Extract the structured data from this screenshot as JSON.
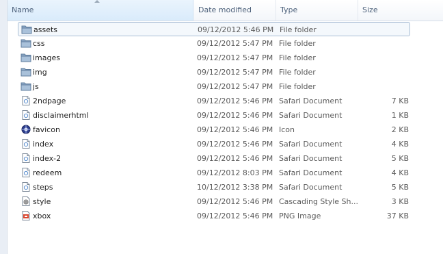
{
  "columns": {
    "name": "Name",
    "date_modified": "Date modified",
    "type": "Type",
    "size": "Size"
  },
  "files": [
    {
      "name": "assets",
      "date": "09/12/2012 5:46 PM",
      "type": "File folder",
      "size": "",
      "icon": "folder-icon",
      "selected": true
    },
    {
      "name": "css",
      "date": "09/12/2012 5:47 PM",
      "type": "File folder",
      "size": "",
      "icon": "folder-icon"
    },
    {
      "name": "images",
      "date": "09/12/2012 5:47 PM",
      "type": "File folder",
      "size": "",
      "icon": "folder-icon"
    },
    {
      "name": "img",
      "date": "09/12/2012 5:47 PM",
      "type": "File folder",
      "size": "",
      "icon": "folder-icon"
    },
    {
      "name": "js",
      "date": "09/12/2012 5:47 PM",
      "type": "File folder",
      "size": "",
      "icon": "folder-icon"
    },
    {
      "name": "2ndpage",
      "date": "09/12/2012 5:46 PM",
      "type": "Safari Document",
      "size": "7 KB",
      "icon": "document-icon"
    },
    {
      "name": "disclaimerhtml",
      "date": "09/12/2012 5:46 PM",
      "type": "Safari Document",
      "size": "1 KB",
      "icon": "document-icon"
    },
    {
      "name": "favicon",
      "date": "09/12/2012 5:46 PM",
      "type": "Icon",
      "size": "2 KB",
      "icon": "favicon-icon"
    },
    {
      "name": "index",
      "date": "09/12/2012 5:46 PM",
      "type": "Safari Document",
      "size": "4 KB",
      "icon": "document-icon"
    },
    {
      "name": "index-2",
      "date": "09/12/2012 5:46 PM",
      "type": "Safari Document",
      "size": "5 KB",
      "icon": "document-icon"
    },
    {
      "name": "redeem",
      "date": "09/12/2012 8:03 PM",
      "type": "Safari Document",
      "size": "4 KB",
      "icon": "document-icon"
    },
    {
      "name": "steps",
      "date": "10/12/2012 3:38 PM",
      "type": "Safari Document",
      "size": "5 KB",
      "icon": "document-icon"
    },
    {
      "name": "style",
      "date": "09/12/2012 5:46 PM",
      "type": "Cascading Style Sh...",
      "size": "3 KB",
      "icon": "stylesheet-icon"
    },
    {
      "name": "xbox",
      "date": "09/12/2012 5:46 PM",
      "type": "PNG Image",
      "size": "37 KB",
      "icon": "image-icon"
    }
  ],
  "colors": {
    "header_text": "#4c607a",
    "sorted_column_bg": "#d9ebfb",
    "selection_border": "#a8bdd4",
    "folder": "#6f8fb1"
  }
}
